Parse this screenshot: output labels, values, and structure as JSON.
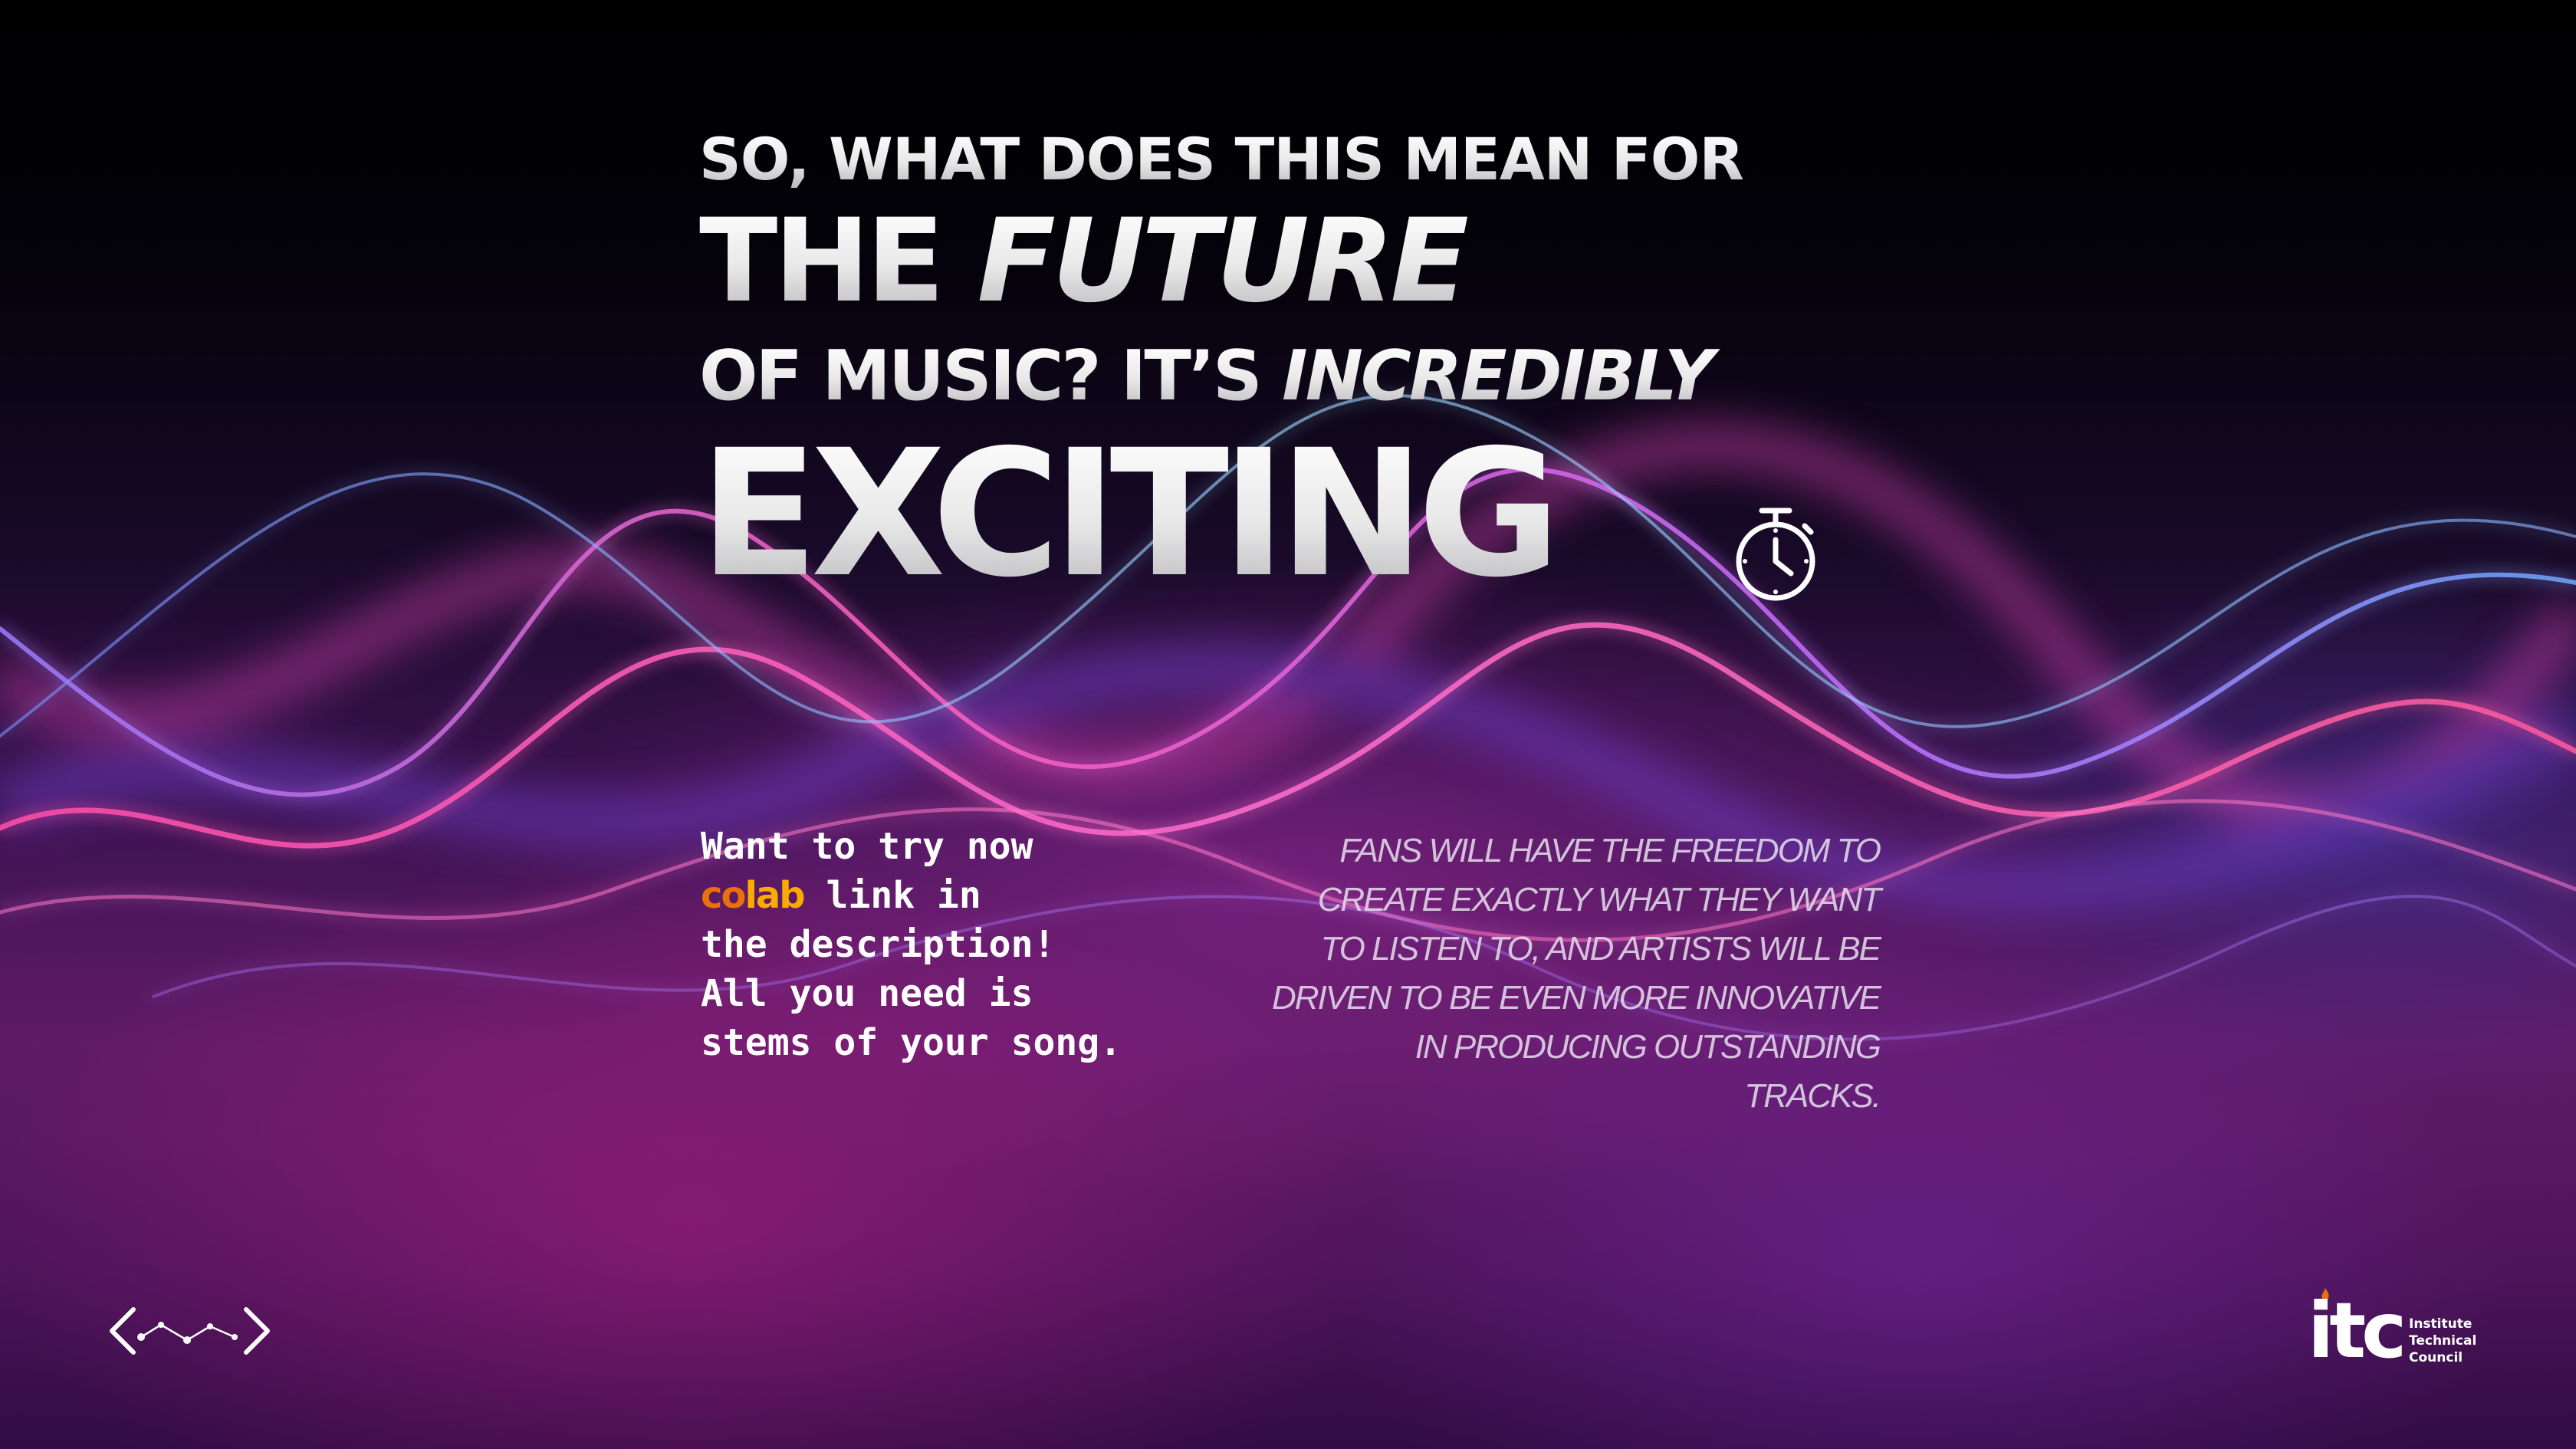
{
  "headline": {
    "line1": "SO, WHAT DOES THIS MEAN FOR",
    "line2_plain": "THE ",
    "line2_italic": "FUTURE",
    "line3_plain": "OF MUSIC? IT’S ",
    "line3_italic": "INCREDIBLY",
    "line4": "EXCITING"
  },
  "cta": {
    "line1": "Want to try now",
    "colab_co": "co",
    "colab_lab": "lab",
    "line2_rest": " link in",
    "line3": "the description!",
    "line4": "All you need is",
    "line5": "stems of your song."
  },
  "quote": {
    "lines": [
      "Fans will have the freedom to",
      "create exactly what they want",
      "to listen to, and artists will be",
      "driven to be even more innovative",
      "in producing outstanding",
      "tracks."
    ]
  },
  "branding": {
    "itc_mark": "itc",
    "itc_lines": [
      "Institute",
      "Technical",
      "Council"
    ]
  },
  "icons": {
    "timer": "stopwatch-icon",
    "nav": "code-constellation-icon",
    "itc": "itc-logo"
  },
  "colors": {
    "headline": "#f2f2f2",
    "colab_orange": "#f9ab00",
    "colab_dark_orange": "#e8710a",
    "background_dark": "#050208",
    "wave_pink": "#ff4fb4",
    "wave_blue": "#7fb4ff"
  }
}
